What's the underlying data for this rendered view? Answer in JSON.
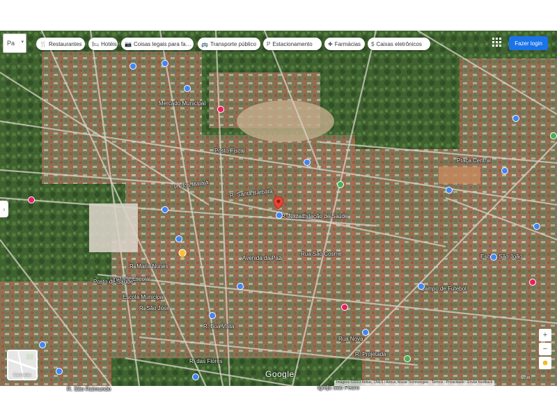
{
  "toolbar": {
    "mode": "Pa",
    "chips": [
      {
        "label": "Restaurantes",
        "icon": "restaurant-icon",
        "glyph": "🍴"
      },
      {
        "label": "Hotéis",
        "icon": "hotel-icon",
        "glyph": "🛏"
      },
      {
        "label": "Coisas legais para fa…",
        "icon": "camera-icon",
        "glyph": "📷"
      },
      {
        "label": "Transporte público",
        "icon": "bus-icon",
        "glyph": "🚌"
      },
      {
        "label": "Estacionamento",
        "icon": "parking-icon",
        "glyph": "P"
      },
      {
        "label": "Farmácias",
        "icon": "pharmacy-icon",
        "glyph": "✚"
      },
      {
        "label": "Caixas eletrônicos",
        "icon": "atm-icon",
        "glyph": "$"
      }
    ],
    "signin_label": "Fazer login"
  },
  "map": {
    "labels": [
      {
        "text": "Mercado Municipal"
      },
      {
        "text": "Posto Fiscal"
      },
      {
        "text": "R. dos Marajá"
      },
      {
        "text": "R. Santa Bárbara"
      },
      {
        "text": "R. Nazaré"
      },
      {
        "text": "Estação de Saúde"
      },
      {
        "text": "Avenida da Paz"
      },
      {
        "text": "Rua São Cosme"
      },
      {
        "text": "R. Maria Nunes"
      },
      {
        "text": "Unidade Escolar"
      },
      {
        "text": "Escola Municipal"
      },
      {
        "text": "Posto de Saúde"
      },
      {
        "text": "R. São José"
      },
      {
        "text": "R. Boa Vista"
      },
      {
        "text": "Rua Nova"
      },
      {
        "text": "R. Projetada"
      },
      {
        "text": "Igreja São Pedro"
      },
      {
        "text": "R. das Flores"
      },
      {
        "text": "Campo de Futebol"
      },
      {
        "text": "Escola São João"
      },
      {
        "text": "Praça Central"
      },
      {
        "text": "R. São Raimundo"
      }
    ],
    "pin_color": "#ea4335",
    "poi_colors": [
      "#4285f4",
      "#e91e63",
      "#4caf50"
    ]
  },
  "layers_label": "Camadas",
  "google_label": "Google",
  "attribution": "Imagens ©2023 Airbus, CNES / Airbus, Maxar Technologies · Termos · Privacidade · Enviar feedback",
  "scale_label": "50 m"
}
